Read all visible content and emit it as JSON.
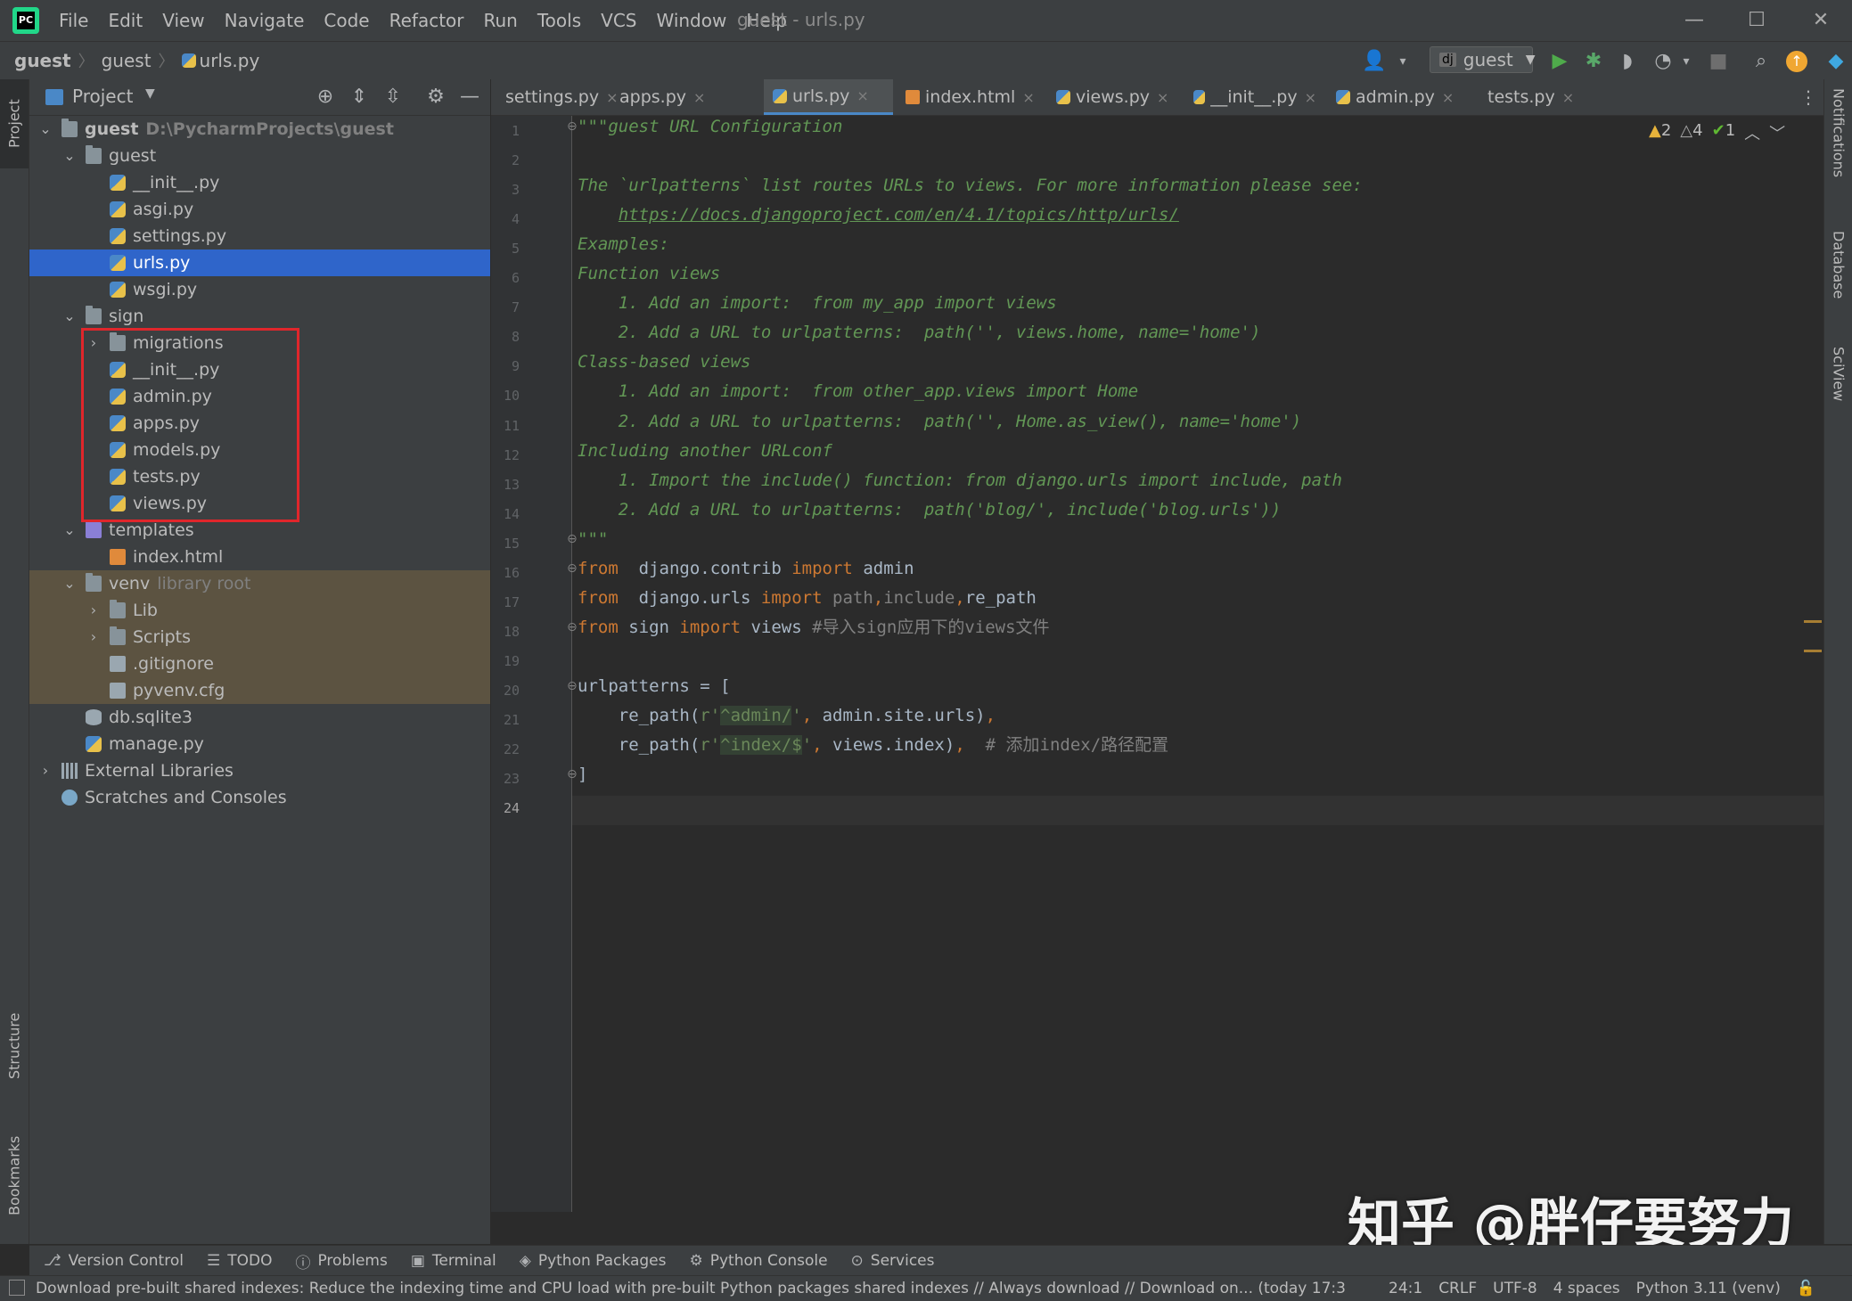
{
  "window": {
    "title": "guest - urls.py",
    "minimize": "—",
    "maximize": "☐",
    "close": "✕"
  },
  "menu": [
    "File",
    "Edit",
    "View",
    "Navigate",
    "Code",
    "Refactor",
    "Run",
    "Tools",
    "VCS",
    "Window",
    "Help"
  ],
  "breadcrumb": [
    "guest",
    "guest",
    "urls.py"
  ],
  "run_config": "guest",
  "project_panel": {
    "title": "Project",
    "tree": [
      {
        "label": "guest",
        "hint": "D:\\PycharmProjects\\guest",
        "depth": 0,
        "arrow": "open",
        "icon": "folder",
        "bold": true
      },
      {
        "label": "guest",
        "depth": 1,
        "arrow": "open",
        "icon": "folder"
      },
      {
        "label": "__init__.py",
        "depth": 2,
        "icon": "py"
      },
      {
        "label": "asgi.py",
        "depth": 2,
        "icon": "py"
      },
      {
        "label": "settings.py",
        "depth": 2,
        "icon": "py"
      },
      {
        "label": "urls.py",
        "depth": 2,
        "icon": "py",
        "selected": true
      },
      {
        "label": "wsgi.py",
        "depth": 2,
        "icon": "py"
      },
      {
        "label": "sign",
        "depth": 1,
        "arrow": "open",
        "icon": "folder"
      },
      {
        "label": "migrations",
        "depth": 2,
        "arrow": "closed",
        "icon": "folder"
      },
      {
        "label": "__init__.py",
        "depth": 2,
        "icon": "py"
      },
      {
        "label": "admin.py",
        "depth": 2,
        "icon": "py"
      },
      {
        "label": "apps.py",
        "depth": 2,
        "icon": "py"
      },
      {
        "label": "models.py",
        "depth": 2,
        "icon": "py"
      },
      {
        "label": "tests.py",
        "depth": 2,
        "icon": "py"
      },
      {
        "label": "views.py",
        "depth": 2,
        "icon": "py"
      },
      {
        "label": "templates",
        "depth": 1,
        "arrow": "open",
        "icon": "folder-purple"
      },
      {
        "label": "index.html",
        "depth": 2,
        "icon": "html"
      },
      {
        "label": "venv",
        "hint": "library root",
        "depth": 1,
        "arrow": "open",
        "icon": "folder",
        "excluded": true
      },
      {
        "label": "Lib",
        "depth": 2,
        "arrow": "closed",
        "icon": "folder",
        "excluded": true
      },
      {
        "label": "Scripts",
        "depth": 2,
        "arrow": "closed",
        "icon": "folder",
        "excluded": true
      },
      {
        "label": ".gitignore",
        "depth": 2,
        "icon": "file",
        "excluded": true
      },
      {
        "label": "pyvenv.cfg",
        "depth": 2,
        "icon": "file",
        "excluded": true
      },
      {
        "label": "db.sqlite3",
        "depth": 1,
        "icon": "db"
      },
      {
        "label": "manage.py",
        "depth": 1,
        "icon": "py"
      },
      {
        "label": "External Libraries",
        "depth": 0,
        "arrow": "closed",
        "icon": "lib"
      },
      {
        "label": "Scratches and Consoles",
        "depth": 0,
        "icon": "scratch"
      }
    ]
  },
  "editor_tabs": [
    {
      "label": "settings.py",
      "icon": "py"
    },
    {
      "label": "apps.py",
      "icon": "py"
    },
    {
      "label": "urls.py",
      "icon": "py",
      "active": true
    },
    {
      "label": "index.html",
      "icon": "html"
    },
    {
      "label": "views.py",
      "icon": "py"
    },
    {
      "label": "__init__.py",
      "icon": "py"
    },
    {
      "label": "admin.py",
      "icon": "py"
    },
    {
      "label": "tests.py",
      "icon": "py"
    }
  ],
  "inspections": {
    "warnings": "2",
    "weak_warnings": "4",
    "typos": "1"
  },
  "code_lines": [
    [
      [
        "doc",
        "\"\"\"guest URL Configuration"
      ]
    ],
    [],
    [
      [
        "doc",
        "The `urlpatterns` list routes URLs to views. For more information please see:"
      ]
    ],
    [
      [
        "doc",
        "    "
      ],
      [
        "doclink",
        "https://docs.djangoproject.com/en/4.1/topics/http/urls/"
      ]
    ],
    [
      [
        "doc",
        "Examples:"
      ]
    ],
    [
      [
        "doc",
        "Function views"
      ]
    ],
    [
      [
        "doc",
        "    1. Add an import:  from my_app import views"
      ]
    ],
    [
      [
        "doc",
        "    2. Add a URL to urlpatterns:  path('', views.home, name='home')"
      ]
    ],
    [
      [
        "doc",
        "Class-based views"
      ]
    ],
    [
      [
        "doc",
        "    1. Add an import:  from other_app.views import Home"
      ]
    ],
    [
      [
        "doc",
        "    2. Add a URL to urlpatterns:  path('', Home.as_view(), name='home')"
      ]
    ],
    [
      [
        "doc",
        "Including another URLconf"
      ]
    ],
    [
      [
        "doc",
        "    1. Import the include() function: from django.urls import include, path"
      ]
    ],
    [
      [
        "doc",
        "    2. Add a URL to urlpatterns:  path('blog/', include('blog.urls'))"
      ]
    ],
    [
      [
        "doc",
        "\"\"\""
      ]
    ],
    [
      [
        "kw",
        "from"
      ],
      [
        "",
        "  django.contrib "
      ],
      [
        "kw",
        "import"
      ],
      [
        "",
        " admin"
      ]
    ],
    [
      [
        "kw",
        "from"
      ],
      [
        "",
        "  django.urls "
      ],
      [
        "kw",
        "import"
      ],
      [
        "dim",
        " path"
      ],
      [
        "kw",
        ","
      ],
      [
        "dim",
        "include"
      ],
      [
        "kw",
        ","
      ],
      [
        "",
        "re_path"
      ]
    ],
    [
      [
        "kw",
        "from"
      ],
      [
        "",
        " sign "
      ],
      [
        "kw",
        "import"
      ],
      [
        "",
        " views "
      ],
      [
        "cmt",
        "#导入sign应用下的views文件"
      ]
    ],
    [],
    [
      [
        "",
        "urlpatterns = ["
      ]
    ],
    [
      [
        "",
        "    re_path("
      ],
      [
        "str",
        "r'"
      ],
      [
        "strbg",
        "^admin/"
      ],
      [
        "str",
        "'"
      ],
      [
        "kw",
        ","
      ],
      [
        "",
        " admin.site.urls)"
      ],
      [
        "kw",
        ","
      ]
    ],
    [
      [
        "",
        "    re_path("
      ],
      [
        "str",
        "r'"
      ],
      [
        "strbg",
        "^index/$"
      ],
      [
        "str",
        "'"
      ],
      [
        "kw",
        ","
      ],
      [
        "",
        " views.index)"
      ],
      [
        "kw",
        ","
      ],
      [
        "cmt",
        "  # 添加index/路径配置"
      ]
    ],
    [
      [
        "",
        "]"
      ]
    ],
    []
  ],
  "current_line": 24,
  "left_tool_windows": [
    "Project",
    "Structure",
    "Bookmarks"
  ],
  "right_tool_windows": [
    "Notifications",
    "Database",
    "SciView"
  ],
  "bottom_tools": [
    "Version Control",
    "TODO",
    "Problems",
    "Terminal",
    "Python Packages",
    "Python Console",
    "Services"
  ],
  "status": {
    "message": "Download pre-built shared indexes: Reduce the indexing time and CPU load with pre-built Python packages shared indexes // Always download // Download on... (today 17:3",
    "position": "24:1",
    "line_sep": "CRLF",
    "encoding": "UTF-8",
    "indent": "4 spaces",
    "interpreter": "Python 3.11 (venv)"
  },
  "watermark": "知乎 @胖仔要努力"
}
